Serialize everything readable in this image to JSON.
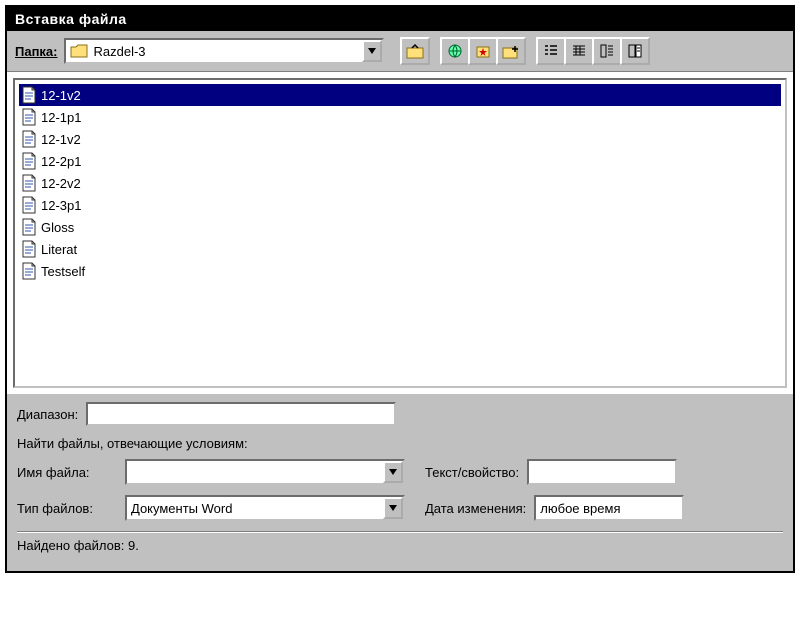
{
  "window": {
    "title": "Вставка файла"
  },
  "toolbar": {
    "folder_label": "Папка:",
    "folder_name": "Razdel-3"
  },
  "files": [
    {
      "name": "12-1v2",
      "selected": true
    },
    {
      "name": "12-1p1",
      "selected": false
    },
    {
      "name": "12-1v2",
      "selected": false
    },
    {
      "name": "12-2p1",
      "selected": false
    },
    {
      "name": "12-2v2",
      "selected": false
    },
    {
      "name": "12-3p1",
      "selected": false
    },
    {
      "name": "Gloss",
      "selected": false
    },
    {
      "name": "Literat",
      "selected": false
    },
    {
      "name": "Testself",
      "selected": false
    }
  ],
  "form": {
    "range_label": "Диапазон:",
    "range_value": "",
    "find_section": "Найти файлы, отвечающие условиям:",
    "filename_label": "Имя файла:",
    "filename_value": "",
    "text_prop_label": "Текст/свойство:",
    "text_prop_value": "",
    "filetype_label": "Тип файлов:",
    "filetype_value": "Документы Word",
    "modified_label": "Дата изменения:",
    "modified_value": "любое время"
  },
  "status": {
    "found": "Найдено файлов: 9."
  }
}
